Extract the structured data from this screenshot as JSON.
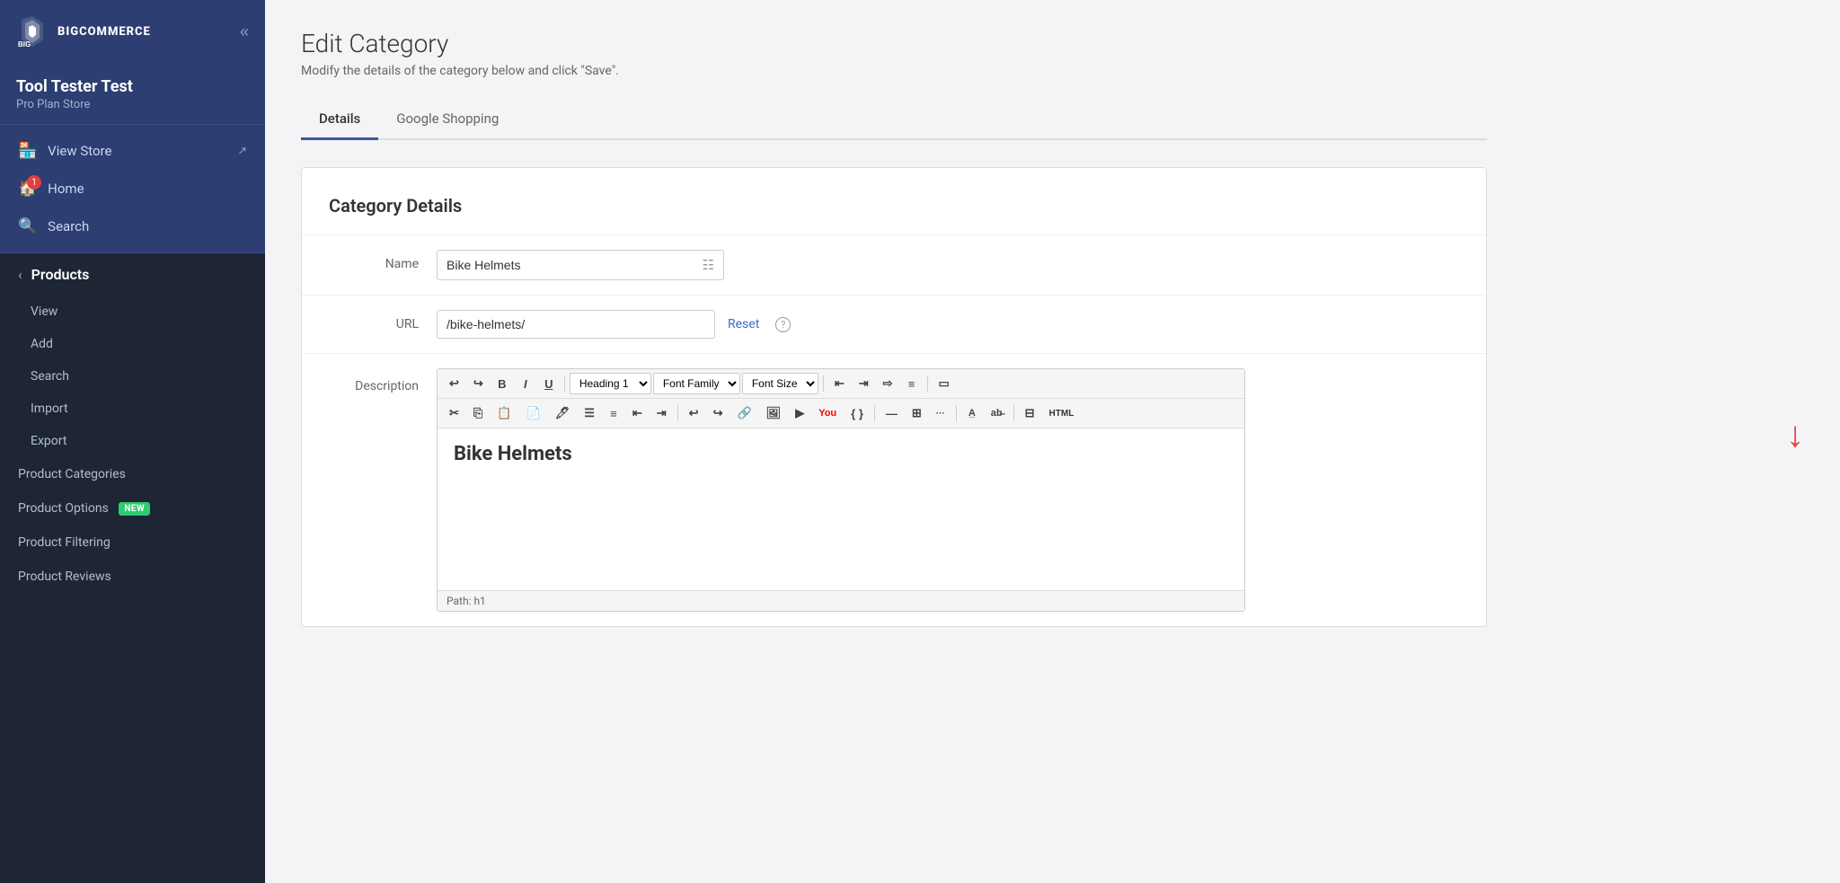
{
  "sidebar": {
    "logo_text": "BIGCOMMERCE",
    "collapse_label": "«",
    "store_name": "Tool Tester Test",
    "store_plan": "Pro Plan Store",
    "nav": [
      {
        "id": "view-store",
        "label": "View Store",
        "icon": "🏪",
        "has_ext": true,
        "badge": null
      },
      {
        "id": "home",
        "label": "Home",
        "icon": "🏠",
        "has_ext": false,
        "badge": "1"
      },
      {
        "id": "search",
        "label": "Search",
        "icon": "🔍",
        "has_ext": false,
        "badge": null
      }
    ],
    "products_header": "Products",
    "products_sub": [
      {
        "id": "view",
        "label": "View"
      },
      {
        "id": "add",
        "label": "Add"
      },
      {
        "id": "search",
        "label": "Search"
      },
      {
        "id": "import",
        "label": "Import"
      },
      {
        "id": "export",
        "label": "Export"
      }
    ],
    "products_sections": [
      {
        "id": "product-categories",
        "label": "Product Categories",
        "badge": null
      },
      {
        "id": "product-options",
        "label": "Product Options",
        "badge": "NEW"
      },
      {
        "id": "product-filtering",
        "label": "Product Filtering",
        "badge": null
      },
      {
        "id": "product-reviews",
        "label": "Product Reviews",
        "badge": null
      }
    ]
  },
  "page": {
    "title": "Edit Category",
    "subtitle": "Modify the details of the category below and click \"Save\".",
    "tabs": [
      {
        "id": "details",
        "label": "Details",
        "active": true
      },
      {
        "id": "google-shopping",
        "label": "Google Shopping",
        "active": false
      }
    ]
  },
  "category_details": {
    "section_title": "Category Details",
    "name_label": "Name",
    "name_value": "Bike Helmets",
    "url_label": "URL",
    "url_value": "/bike-helmets/",
    "reset_label": "Reset",
    "description_label": "Description",
    "editor": {
      "toolbar1": {
        "undo": "↩",
        "redo": "↪",
        "bold": "B",
        "italic": "I",
        "underline": "U",
        "heading_select": "Heading 1",
        "font_family": "Font Family",
        "font_size": "Font Size",
        "align_left": "≡",
        "align_center": "≡",
        "align_right": "≡",
        "align_justify": "≡",
        "block": "▭"
      },
      "content_heading": "Bike Helmets",
      "statusbar": "Path: h1"
    }
  }
}
